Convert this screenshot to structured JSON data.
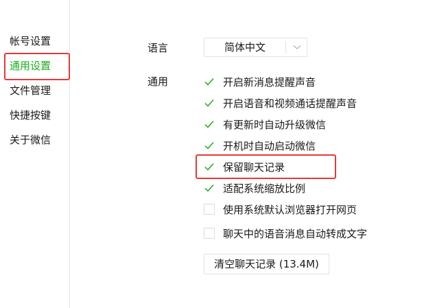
{
  "sidebar": {
    "items": [
      {
        "label": "帐号设置",
        "active": false
      },
      {
        "label": "通用设置",
        "active": true
      },
      {
        "label": "文件管理",
        "active": false
      },
      {
        "label": "快捷按键",
        "active": false
      },
      {
        "label": "关于微信",
        "active": false
      }
    ]
  },
  "language": {
    "label": "语言",
    "selected": "简体中文",
    "arrow_icon": "chevron-down-icon"
  },
  "general": {
    "label": "通用",
    "options": [
      {
        "label": "开启新消息提醒声音",
        "checked": true
      },
      {
        "label": "开启语音和视频通话提醒声音",
        "checked": true
      },
      {
        "label": "有更新时自动升级微信",
        "checked": true
      },
      {
        "label": "开机时自动启动微信",
        "checked": true
      },
      {
        "label": "保留聊天记录",
        "checked": true
      },
      {
        "label": "适配系统缩放比例",
        "checked": true
      },
      {
        "label": "使用系统默认浏览器打开网页",
        "checked": false
      },
      {
        "label": "聊天中的语音消息自动转成文字",
        "checked": false
      }
    ]
  },
  "clear_history": {
    "label": "清空聊天记录 (13.4M)"
  },
  "colors": {
    "accent_green": "#1aad19",
    "highlight_red": "#e53935"
  }
}
